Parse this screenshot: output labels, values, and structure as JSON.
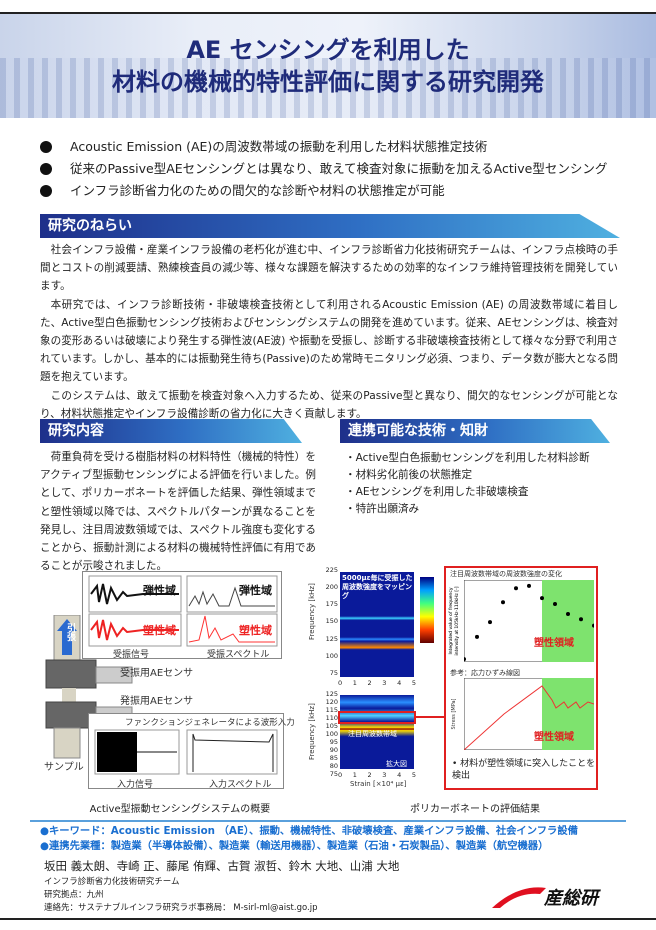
{
  "header": {
    "title_line1": "AE センシングを利用した",
    "title_line2": "材料の機械的特性評価に関する研究開発"
  },
  "highlights": [
    "Acoustic Emission (AE)の周波数帯域の振動を利用した材料状態推定技術",
    "従来のPassive型AEセンシングとは異なり、敢えて検査対象に振動を加えるActive型センシング",
    "インフラ診断省力化のための間欠的な診断や材料の状態推定が可能"
  ],
  "aim": {
    "heading": "研究のねらい",
    "paragraphs": [
      "社会インフラ設備・産業インフラ設備の老朽化が進む中、インフラ診断省力化技術研究チームは、インフラ点検時の手間とコストの削減要請、熟練検査員の減少等、様々な課題を解決するための効率的なインフラ維持管理技術を開発しています。",
      "本研究では、インフラ診断技術・非破壊検査技術として利用されるAcoustic Emission (AE) の周波数帯域に着目した、Active型白色振動センシング技術およびセンシングシステムの開発を進めています。従来、AEセンシングは、検査対象の変形あるいは破壊により発生する弾性波(AE波) や振動を受振し、診断する非破壊検査技術として様々な分野で利用されています。しかし、基本的には振動発生待ち(Passive)のため常時モニタリング必須、つまり、データ数が膨大となる問題を抱えています。",
      "このシステムは、敢えて振動を検査対象へ入力するため、従来のPassive型と異なり、間欠的なセンシングが可能となり、材料状態推定やインフラ設備診断の省力化に大きく貢献します。"
    ]
  },
  "content": {
    "heading": "研究内容",
    "text": "荷重負荷を受ける樹脂材料の材料特性（機械的特性）をアクティブ型振動センシングによる評価を行いました。例として、ポリカーボネートを評価した結果、弾性領域までと塑性領域以降では、スペクトルパターンが異なることを発見し、注目周波数領域では、スペクトル強度も変化することから、振動計測による材料の機械特性評価に有用であることが示唆されました。"
  },
  "tech": {
    "heading": "連携可能な技術・知財",
    "items": [
      "・Active型白色振動センシングを利用した材料診断",
      "・材料劣化前後の状態推定",
      "・AEセンシングを利用した非破壊検査",
      "・特許出願済み"
    ]
  },
  "fig1": {
    "caption": "Active型振動センシングシステムの概要",
    "elastic": "弾性域",
    "plastic": "塑性域",
    "recv_signal": "受振信号",
    "recv_spectrum": "受振スペクトル",
    "pull": "引張",
    "recv_sensor": "受振用AEセンサ",
    "send_sensor": "発振用AEセンサ",
    "fg_input": "ファンクションジェネレータによる波形入力",
    "input_signal": "入力信号",
    "input_spectrum": "入力スペクトル",
    "sample": "サンプル"
  },
  "fig2": {
    "caption": "ポリカーボネートの評価結果",
    "map_note": "5000με毎に受振した周波数強度をマッピング",
    "freq_label": "Frequency [kHz]",
    "strain_label": "Strain [×10⁴ με]",
    "focus_band": "注目周波数帯域",
    "zoom_view": "拡大図",
    "top_ticks": [
      "225",
      "200",
      "175",
      "150",
      "125",
      "100",
      "75"
    ],
    "bot_ticks": [
      "125",
      "120",
      "115",
      "110",
      "105",
      "100",
      "95",
      "90",
      "85",
      "80",
      "75"
    ],
    "x_ticks": [
      "0",
      "1",
      "2",
      "3",
      "4",
      "5"
    ],
    "plastic_region": "塑性領域",
    "scatter_title": "注目周波数帯域の周波数強度の変化",
    "scatter_ylabel": "Integrated value of frequency intensity at 105kHz-110kHz [-]",
    "ss_title": "参考：応力ひずみ線図",
    "ss_ylabel": "Stress [MPa]",
    "detect_note": "材料が塑性領域に突入したことを検出",
    "plastic_color": "#7ee36e",
    "highlight_color": "#e02020"
  },
  "chart_data": {
    "type": "scatter",
    "title": "注目周波数帯域の周波数強度の変化",
    "xlabel": "Strain [×10⁴ με]",
    "ylabel": "Integrated value of frequency intensity at 105kHz-110kHz [-]",
    "xlim": [
      0,
      5
    ],
    "ylim": [
      110,
      250
    ],
    "x": [
      0,
      0.5,
      1,
      1.5,
      2,
      2.5,
      3,
      3.5,
      4,
      4.5,
      5
    ],
    "y": [
      115,
      153,
      178,
      212,
      236,
      240,
      219,
      209,
      192,
      183,
      172
    ],
    "plastic_from": 3
  },
  "footer": {
    "keywords": "●キーワード：Acoustic Emission （AE）、振動、機械特性、非破壊検査、産業インフラ設備、社会インフラ設備",
    "industries": "●連携先業種：製造業（半導体設備）、製造業（輸送用機器）、製造業（石油・石炭製品）、製造業（航空機器）",
    "authors": "坂田 義太朗、寺崎 正、藤尾 侑輝、古賀 淑哲、鈴木 大地、山浦 大地",
    "team": "インフラ診断省力化技術研究チーム",
    "base": "研究拠点：九州",
    "contact": "連絡先：サステナブルインフラ研究ラボ事務局： M-sirl-ml@aist.go.jp",
    "logo_text": "産総研"
  }
}
